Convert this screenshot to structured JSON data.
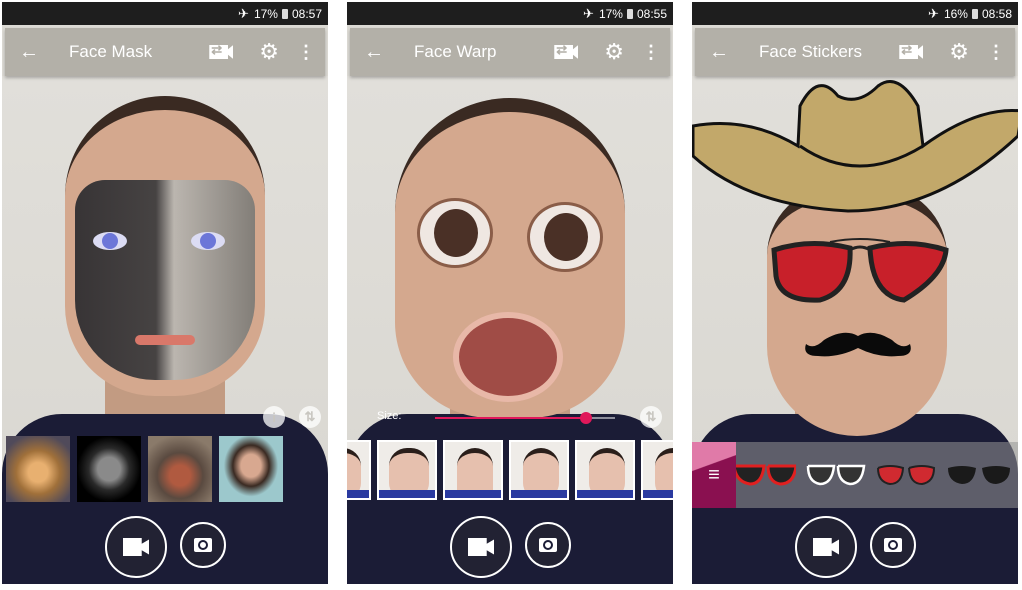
{
  "screens": [
    {
      "status": {
        "battery": "17%",
        "time": "08:57"
      },
      "toolbar": {
        "title": "Face Mask"
      },
      "icons": {
        "back": "←",
        "settings": "⚙",
        "more": "⋮",
        "info": "i",
        "swap": "⇅"
      },
      "thumbnails": [
        "Jaguar",
        "Skull",
        "Orangutan",
        "Abraham Lincoln"
      ]
    },
    {
      "status": {
        "battery": "17%",
        "time": "08:55"
      },
      "toolbar": {
        "title": "Face Warp"
      },
      "icons": {
        "back": "←",
        "settings": "⚙",
        "more": "⋮",
        "swap": "⇅"
      },
      "size_slider": {
        "label": "Size:",
        "value_fraction": 0.84
      },
      "thumbnails": [
        "Open mouth warp",
        "Puffy cheeks warp",
        "Alien warp",
        "Big eyes warp",
        "Twisted face warp",
        "Partial warp"
      ]
    },
    {
      "status": {
        "battery": "16%",
        "time": "08:58"
      },
      "toolbar": {
        "title": "Face Stickers"
      },
      "icons": {
        "back": "←",
        "settings": "⚙",
        "more": "⋮",
        "menu": "≡"
      },
      "stickers": [
        "Red frame sunglasses",
        "White frame sunglasses",
        "Red aviators",
        "Black sunglasses"
      ]
    }
  ],
  "colors": {
    "accent": "#e0185a",
    "toolbar": "#b3b0a8",
    "statusbar": "#1e1e1e",
    "sticker_menu": "#8a1050"
  }
}
